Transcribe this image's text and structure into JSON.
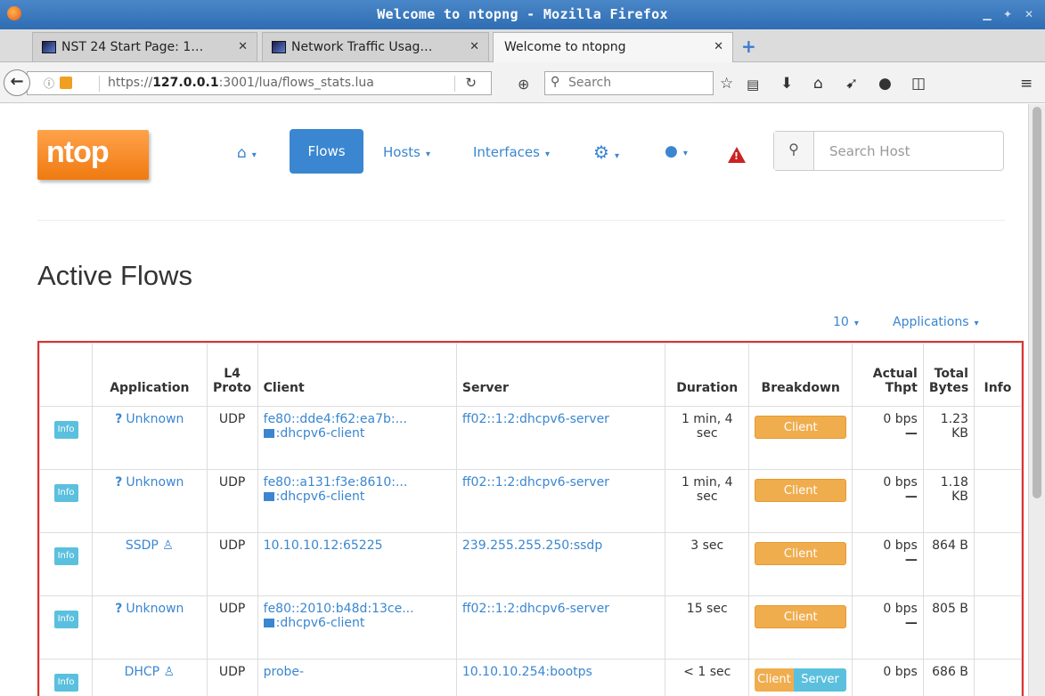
{
  "window": {
    "title": "Welcome to ntopng - Mozilla Firefox"
  },
  "tabs": [
    {
      "label": "NST 24 Start Page: 1…"
    },
    {
      "label": "Network Traffic Usag…"
    },
    {
      "label": "Welcome to ntopng"
    }
  ],
  "navbar": {
    "url_prefix": "https://",
    "url_host": "127.0.0.1",
    "url_rest": ":3001/lua/flows_stats.lua",
    "search_placeholder": "Search"
  },
  "app": {
    "logo_text": "ntop",
    "menu": {
      "flows": "Flows",
      "hosts": "Hosts",
      "interfaces": "Interfaces"
    },
    "host_search_placeholder": "Search Host",
    "page_title": "Active Flows",
    "pager_count": "10",
    "pager_filter": "Applications"
  },
  "table": {
    "headers": {
      "application": "Application",
      "l4": "L4",
      "proto": "Proto",
      "client": "Client",
      "server": "Server",
      "duration": "Duration",
      "breakdown": "Breakdown",
      "actual": "Actual",
      "thpt": "Thpt",
      "total": "Total",
      "bytes": "Bytes",
      "info": "Info"
    },
    "info_label": "Info",
    "rows": [
      {
        "app": "Unknown",
        "proto": "UDP",
        "client": "fe80::dde4:f62:ea7b:...",
        "client_sub": ":dhcpv6-client",
        "server": "ff02::1:2:dhcpv6-server",
        "duration1": "1 min, 4",
        "duration2": "sec",
        "breakdown_client": "Client",
        "breakdown_server": "",
        "thpt": "0 bps",
        "bytes1": "1.23",
        "bytes2": "KB"
      },
      {
        "app": "Unknown",
        "proto": "UDP",
        "client": "fe80::a131:f3e:8610:...",
        "client_sub": ":dhcpv6-client",
        "server": "ff02::1:2:dhcpv6-server",
        "duration1": "1 min, 4",
        "duration2": "sec",
        "breakdown_client": "Client",
        "breakdown_server": "",
        "thpt": "0 bps",
        "bytes1": "1.18",
        "bytes2": "KB"
      },
      {
        "app": "SSDP",
        "proto": "UDP",
        "client": "10.10.10.12:65225",
        "client_sub": "",
        "server": "239.255.255.250:ssdp",
        "duration1": "3 sec",
        "duration2": "",
        "breakdown_client": "Client",
        "breakdown_server": "",
        "thpt": "0 bps",
        "bytes1": "864 B",
        "bytes2": ""
      },
      {
        "app": "Unknown",
        "proto": "UDP",
        "client": "fe80::2010:b48d:13ce...",
        "client_sub": ":dhcpv6-client",
        "server": "ff02::1:2:dhcpv6-server",
        "duration1": "15 sec",
        "duration2": "",
        "breakdown_client": "Client",
        "breakdown_server": "",
        "thpt": "0 bps",
        "bytes1": "805 B",
        "bytes2": ""
      },
      {
        "app": "DHCP",
        "proto": "UDP",
        "client": "probe-",
        "client_sub": "",
        "server": "10.10.10.254:bootps",
        "duration1": "< 1 sec",
        "duration2": "",
        "breakdown_client": "Client",
        "breakdown_server": "Server",
        "thpt": "0 bps",
        "bytes1": "686 B",
        "bytes2": ""
      }
    ]
  }
}
